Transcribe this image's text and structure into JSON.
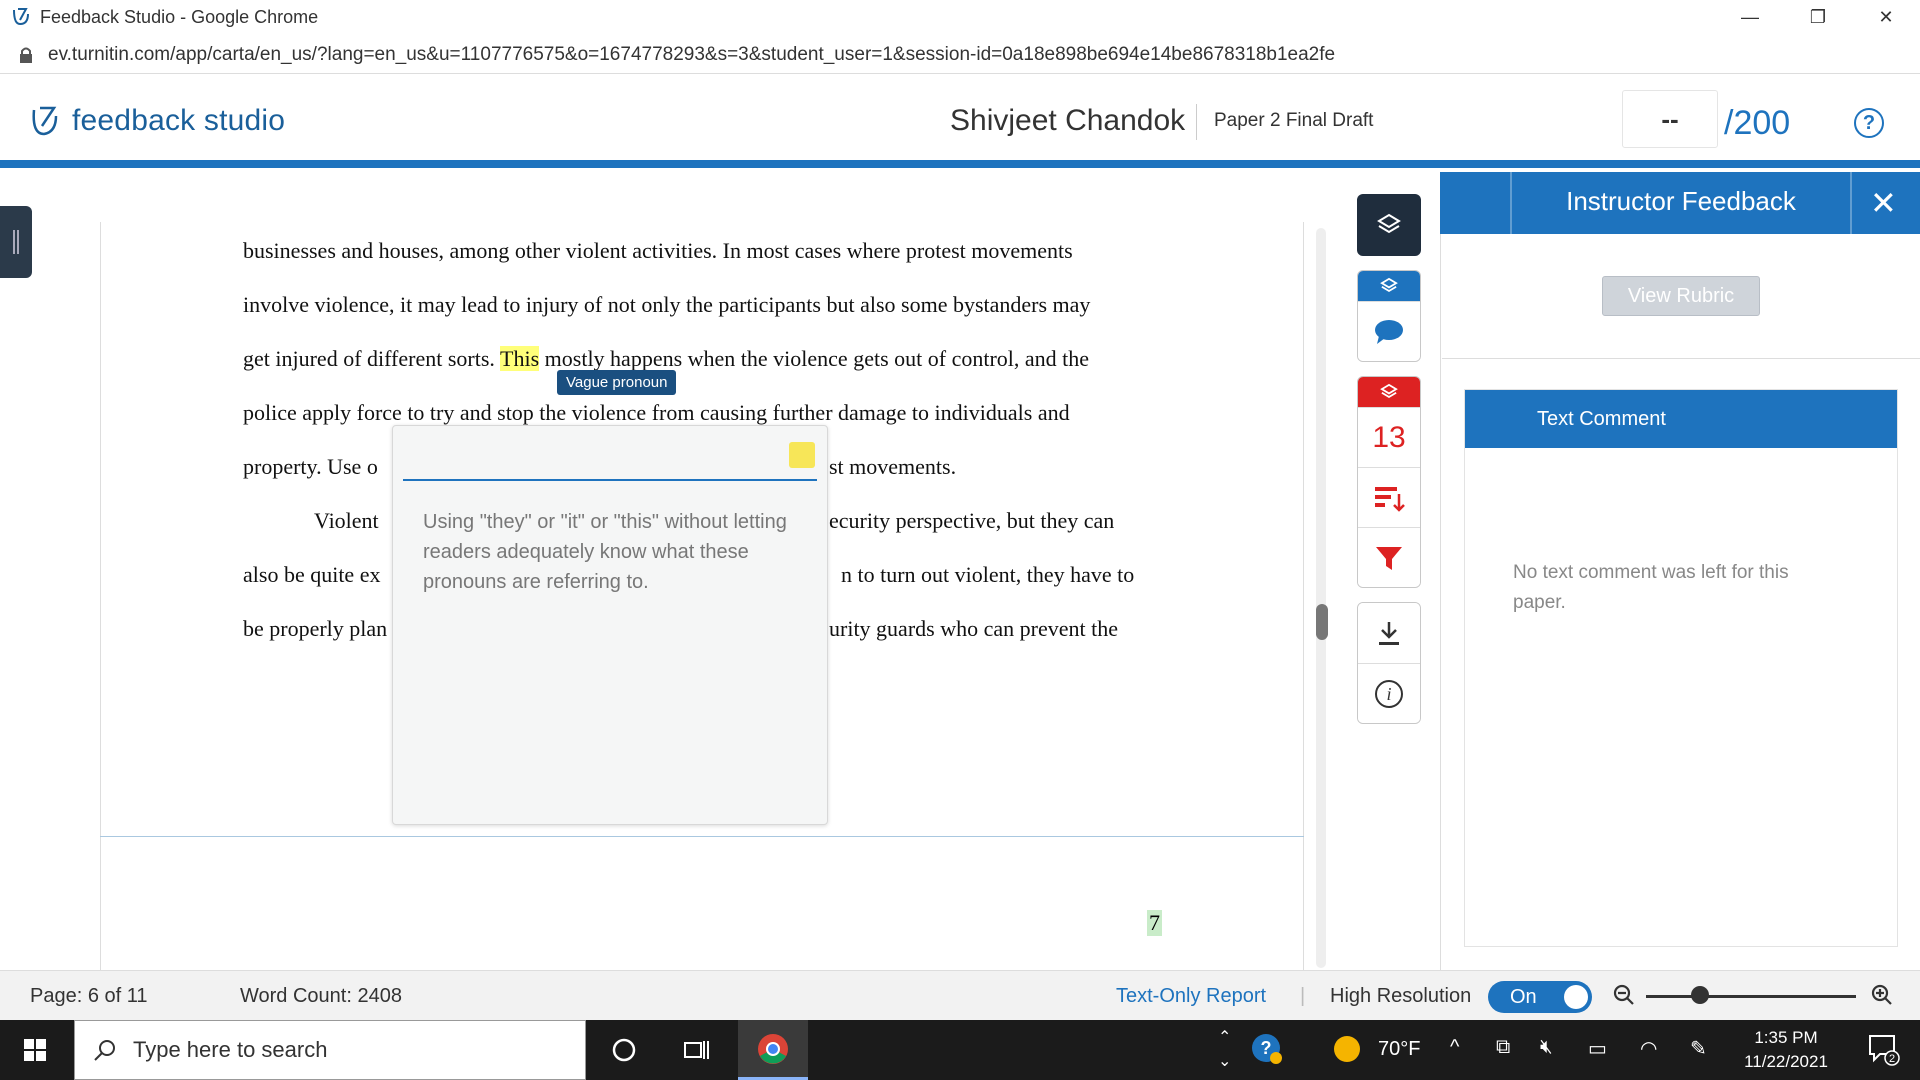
{
  "browser": {
    "window_title": "Feedback Studio - Google Chrome",
    "url": "ev.turnitin.com/app/carta/en_us/?lang=en_us&u=1107776575&o=1674778293&s=3&student_user=1&session-id=0a18e898be694e14be8678318b1ea2fe"
  },
  "header": {
    "logo_text": "feedback studio",
    "student_name": "Shivjeet Chandok",
    "paper_title": "Paper 2 Final Draft",
    "score_value": "--",
    "score_total": "/200",
    "help_label": "?"
  },
  "document": {
    "lines": [
      {
        "text": "businesses and houses, among other violent activities. In most cases where protest movements"
      },
      {
        "text": "involve violence, it may lead to injury of not only the participants but also some bystanders may"
      },
      {
        "pre": "get injured of different sorts. ",
        "highlight": "This",
        "post": " mostly happens when the violence gets out of control, and the"
      },
      {
        "text": "police apply force to try and stop the violence from causing further damage to individuals and"
      },
      {
        "text": "property. Use o",
        "text_right": "st movements."
      },
      {
        "text": "Violent ",
        "text_right": "ecurity perspective, but they can"
      },
      {
        "text": "also be quite ex",
        "text_right": "n to turn out violent, they have to"
      },
      {
        "text": "be properly plan",
        "text_right": "urity guards who can prevent the"
      }
    ],
    "page_number": "7"
  },
  "tooltip": {
    "label": "Vague pronoun"
  },
  "comment_popup": {
    "text": "Using \"they\" or \"it\" or \"this\" without letting readers adequately know what these pronouns are referring to."
  },
  "tools": {
    "count": "13"
  },
  "instructor_panel": {
    "title": "Instructor Feedback",
    "view_rubric": "View Rubric",
    "text_comment_title": "Text Comment",
    "no_comment": "No text comment was left for this paper."
  },
  "statusbar": {
    "page": "Page: 6 of 11",
    "word_count": "Word Count: 2408",
    "text_only": "Text-Only Report",
    "high_res_label": "High Resolution",
    "toggle_state": "On"
  },
  "taskbar": {
    "search_placeholder": "Type here to search",
    "temperature": "70°F",
    "time": "1:35 PM",
    "date": "11/22/2021",
    "notification_count": "2"
  },
  "colors": {
    "brand_blue": "#1e73be",
    "dark_navy": "#1f2d3d",
    "alert_red": "#d22222",
    "highlight_yellow": "#ffff7a"
  }
}
